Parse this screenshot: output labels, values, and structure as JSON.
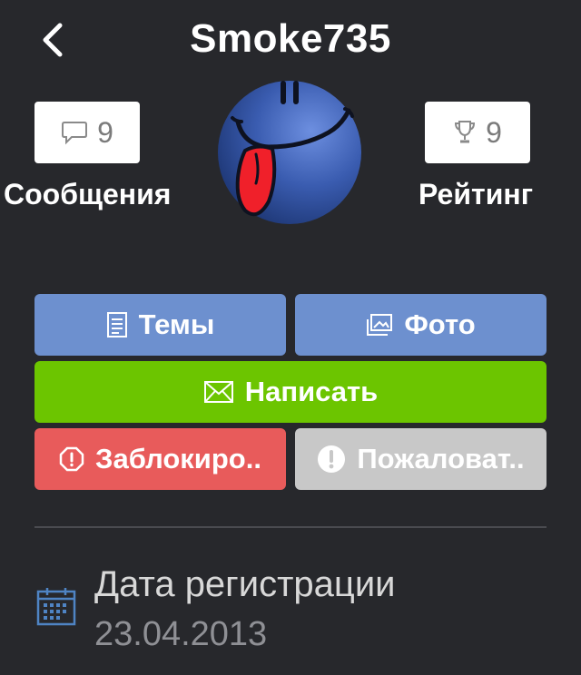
{
  "header": {
    "title": "Smoke735",
    "back_icon": "chevron-left-icon"
  },
  "stats": {
    "messages": {
      "count": "9",
      "label": "Сообщения",
      "icon": "speech-bubble-icon"
    },
    "rating": {
      "count": "9",
      "label": "Рейтинг",
      "icon": "trophy-icon"
    }
  },
  "avatar": {
    "icon": "smiley-tongue-icon"
  },
  "actions": {
    "topics": {
      "label": "Темы",
      "icon": "document-icon",
      "color": "#6d90cf"
    },
    "photo": {
      "label": "Фото",
      "icon": "image-icon",
      "color": "#6d90cf"
    },
    "write": {
      "label": "Написать",
      "icon": "envelope-icon",
      "color": "#6cc500"
    },
    "block": {
      "label": "Заблокиро..",
      "icon": "stop-octagon-icon",
      "color": "#e85b5b"
    },
    "report": {
      "label": "Пожаловат..",
      "icon": "alert-circle-icon",
      "color": "#c8c8c8"
    }
  },
  "registration": {
    "label": "Дата регистрации",
    "value": "23.04.2013",
    "icon": "calendar-icon"
  },
  "colors": {
    "background": "#27282c",
    "accent_blue": "#6d90cf",
    "accent_green": "#6cc500",
    "accent_red": "#e85b5b",
    "calendar_blue": "#4f84c4"
  }
}
